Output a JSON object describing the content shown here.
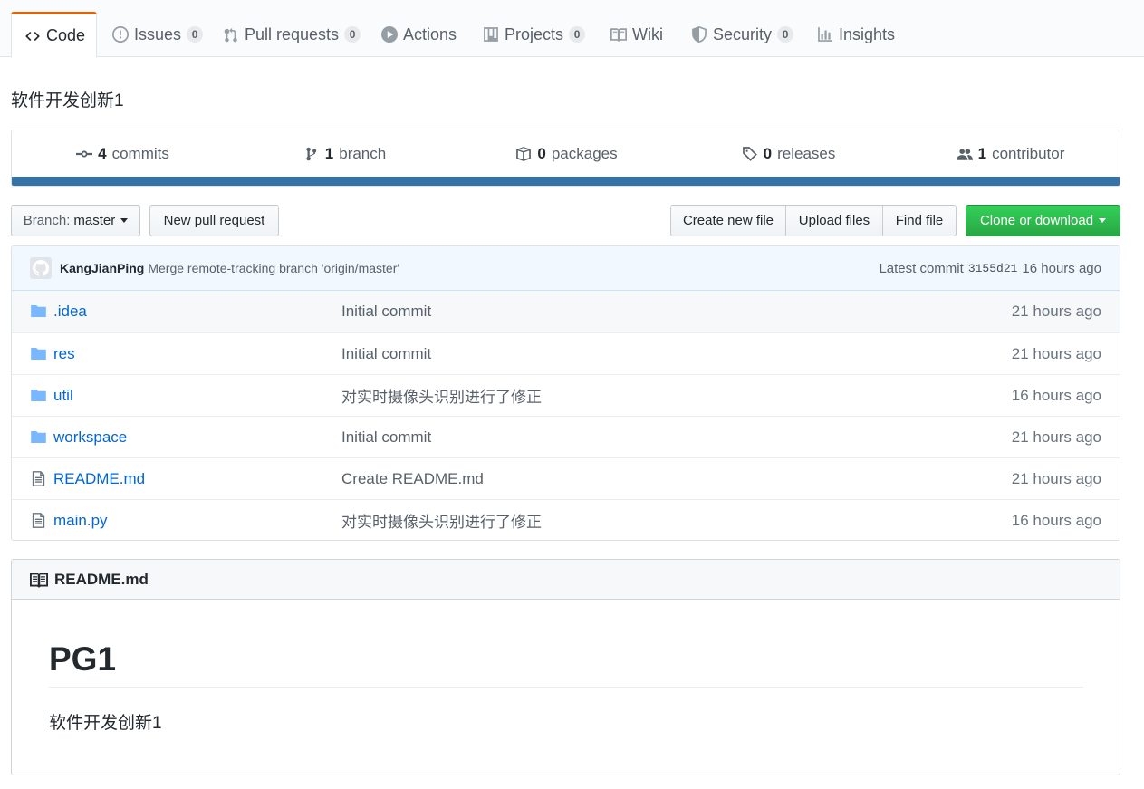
{
  "tabs": [
    {
      "label": "Code",
      "icon": "code-icon"
    },
    {
      "label": "Issues",
      "count": "0",
      "icon": "issue-icon"
    },
    {
      "label": "Pull requests",
      "count": "0",
      "icon": "pull-request-icon"
    },
    {
      "label": "Actions",
      "icon": "play-icon"
    },
    {
      "label": "Projects",
      "count": "0",
      "icon": "project-icon"
    },
    {
      "label": "Wiki",
      "icon": "book-icon"
    },
    {
      "label": "Security",
      "count": "0",
      "icon": "shield-icon"
    },
    {
      "label": "Insights",
      "icon": "graph-icon"
    }
  ],
  "repo": {
    "description": "软件开发创新1"
  },
  "summary": {
    "commits": {
      "count": "4",
      "label": "commits"
    },
    "branches": {
      "count": "1",
      "label": "branch"
    },
    "packages": {
      "count": "0",
      "label": "packages"
    },
    "releases": {
      "count": "0",
      "label": "releases"
    },
    "contributors": {
      "count": "1",
      "label": "contributor"
    },
    "language_color": "#3572A5"
  },
  "toolbar": {
    "branch_prefix": "Branch:",
    "branch_name": "master",
    "new_pull_request": "New pull request",
    "create_new_file": "Create new file",
    "upload_files": "Upload files",
    "find_file": "Find file",
    "clone_or_download": "Clone or download"
  },
  "latest_commit": {
    "author": "KangJianPing",
    "message": "Merge remote-tracking branch 'origin/master'",
    "label": "Latest commit",
    "sha": "3155d21",
    "age": "16 hours ago"
  },
  "files": [
    {
      "name": ".idea",
      "type": "folder",
      "message": "Initial commit",
      "age": "21 hours ago"
    },
    {
      "name": "res",
      "type": "folder",
      "message": "Initial commit",
      "age": "21 hours ago"
    },
    {
      "name": "util",
      "type": "folder",
      "message": "对实时摄像头识别进行了修正",
      "age": "16 hours ago"
    },
    {
      "name": "workspace",
      "type": "folder",
      "message": "Initial commit",
      "age": "21 hours ago"
    },
    {
      "name": "README.md",
      "type": "file",
      "message": "Create README.md",
      "age": "21 hours ago"
    },
    {
      "name": "main.py",
      "type": "file",
      "message": "对实时摄像头识别进行了修正",
      "age": "16 hours ago"
    }
  ],
  "readme": {
    "filename": "README.md",
    "heading": "PG1",
    "paragraph": "软件开发创新1"
  },
  "colors": {
    "accent": "#e36209",
    "link": "#0366d6",
    "green": "#28a745",
    "folder": "#79b8ff"
  }
}
